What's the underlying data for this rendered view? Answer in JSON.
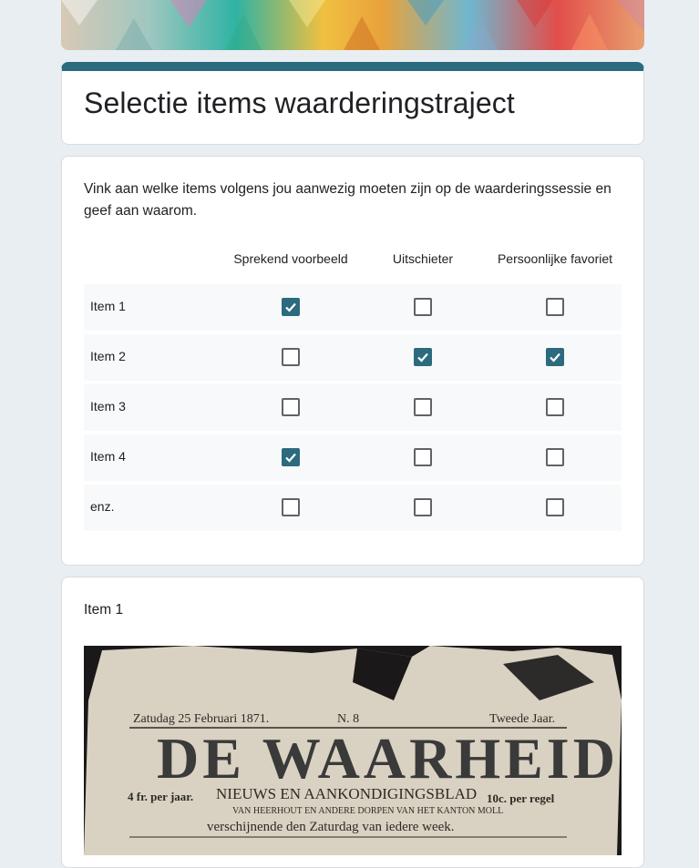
{
  "form": {
    "title": "Selectie items waarderingstraject",
    "accent_color": "#2c6a7e"
  },
  "question": {
    "text": "Vink aan welke items volgens jou aanwezig moeten zijn op de waarderingssessie en geef aan waarom.",
    "columns": [
      "Sprekend voorbeeld",
      "Uitschieter",
      "Persoonlijke favoriet"
    ],
    "rows": [
      {
        "label": "Item 1",
        "checked": [
          true,
          false,
          false
        ]
      },
      {
        "label": "Item 2",
        "checked": [
          false,
          true,
          true
        ]
      },
      {
        "label": "Item 3",
        "checked": [
          false,
          false,
          false
        ]
      },
      {
        "label": "Item 4",
        "checked": [
          true,
          false,
          false
        ]
      },
      {
        "label": "enz.",
        "checked": [
          false,
          false,
          false
        ]
      }
    ]
  },
  "image_item": {
    "title": "Item 1",
    "newspaper": {
      "date_line": "Zatudag 25 Februari 1871.",
      "issue": "N. 8",
      "year": "Tweede Jaar.",
      "masthead": "DE WAARHEID",
      "subtitle": "NIEUWS EN AANKONDIGINGSBLAD",
      "subline": "VAN HEERHOUT EN ANDERE DORPEN VAN HET KANTON MOLL",
      "frequency": "verschijnende den Zaturdag van iedere week.",
      "price_left": "4 fr. per jaar.",
      "price_right": "10c. per regel"
    }
  }
}
